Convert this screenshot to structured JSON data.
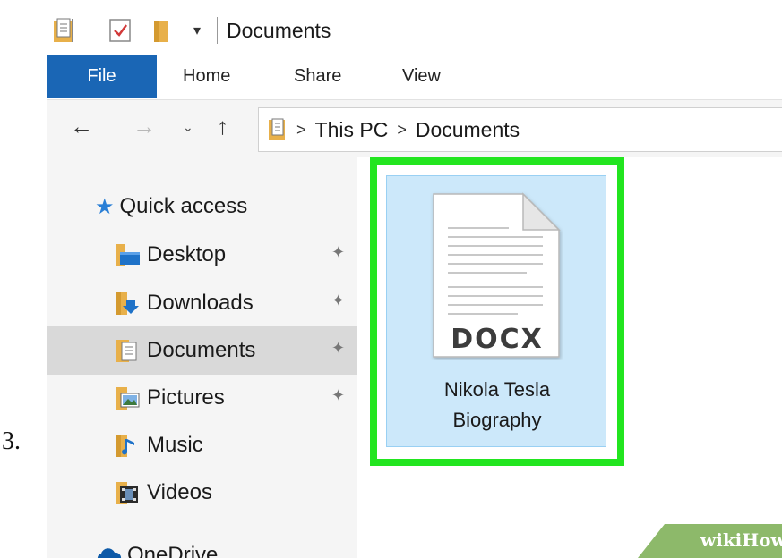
{
  "step_number": "3.",
  "window": {
    "title": "Documents",
    "quick_access_toolbar": [
      "folder-doc-icon",
      "checkmark-doc-icon",
      "folder-icon",
      "dropdown-arrow-icon"
    ]
  },
  "ribbon": {
    "tabs": [
      {
        "label": "File",
        "active": true
      },
      {
        "label": "Home"
      },
      {
        "label": "Share"
      },
      {
        "label": "View"
      }
    ],
    "accent": "#1a66b5"
  },
  "nav": {
    "back": "←",
    "forward": "→",
    "recent": "⌄",
    "up": "↑",
    "breadcrumb": [
      "This PC",
      "Documents"
    ],
    "separator": ">"
  },
  "sidebar": {
    "items": [
      {
        "label": "Quick access",
        "icon": "star-icon"
      },
      {
        "label": "Desktop",
        "icon": "desktop-folder-icon",
        "pinned": true
      },
      {
        "label": "Downloads",
        "icon": "downloads-folder-icon",
        "pinned": true
      },
      {
        "label": "Documents",
        "icon": "documents-folder-icon",
        "pinned": true,
        "selected": true
      },
      {
        "label": "Pictures",
        "icon": "pictures-folder-icon",
        "pinned": true
      },
      {
        "label": "Music",
        "icon": "music-folder-icon"
      },
      {
        "label": "Videos",
        "icon": "videos-folder-icon"
      },
      {
        "label": "OneDrive",
        "icon": "onedrive-icon"
      }
    ],
    "pin_glyph": "📌"
  },
  "content": {
    "file": {
      "type_label": "DOCX",
      "name_line1": "Nikola Tesla",
      "name_line2": "Biography",
      "selected": true
    },
    "highlight_color": "#22e51f",
    "selection_color": "#cce8fa"
  },
  "watermark": {
    "text": "wikiHow"
  }
}
